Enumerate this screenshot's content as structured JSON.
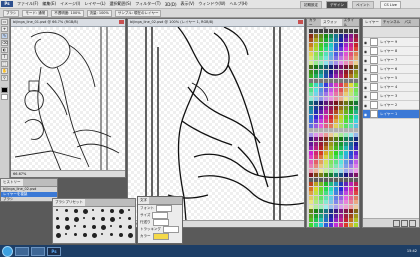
{
  "menubar": {
    "app_badge": "Ps",
    "items": [
      "ファイル(F)",
      "編集(E)",
      "イメージ(I)",
      "レイヤー(L)",
      "選択範囲(S)",
      "フィルター(T)",
      "3D(D)",
      "表示(V)",
      "ウィンドウ(W)",
      "ヘルプ(H)"
    ],
    "workspace_a": "初期設定",
    "workspace_b": "デザイン",
    "workspace_c": "ペイント",
    "search_label": "CS Live"
  },
  "optbar": {
    "items": [
      "ブラシ",
      "モード: 通常",
      "不透明度: 100%",
      "流量: 100%",
      "サンプル: 現在のレイヤー"
    ]
  },
  "toolbar": {
    "tools": [
      "▭",
      "⌖",
      "✎",
      "⌫",
      "◐",
      "T",
      "⬚",
      "✋",
      "⚲"
    ]
  },
  "doc_left": {
    "title": "bijinga_line_01.psd @ 66.7% (RGB/8)",
    "status": "66.67%"
  },
  "doc_main": {
    "title": "bijinga_line_02.psd @ 100% (レイヤー 1, RGB/8)",
    "status": "100%"
  },
  "swatches": {
    "tabs": [
      "カラー",
      "スウォッチ",
      "スタイル"
    ]
  },
  "layers": {
    "tabs": [
      "レイヤー",
      "チャンネル",
      "パス"
    ],
    "rows": [
      {
        "label": "レイヤー 9",
        "selected": false
      },
      {
        "label": "レイヤー 8",
        "selected": false
      },
      {
        "label": "レイヤー 7",
        "selected": false
      },
      {
        "label": "レイヤー 6",
        "selected": false
      },
      {
        "label": "レイヤー 5",
        "selected": false
      },
      {
        "label": "レイヤー 4",
        "selected": false
      },
      {
        "label": "レイヤー 3",
        "selected": false
      },
      {
        "label": "レイヤー 2",
        "selected": false
      },
      {
        "label": "レイヤー 1",
        "selected": true
      }
    ]
  },
  "history": {
    "tab": "ヒストリー",
    "rows": [
      "bijinga_line_02.psd",
      "レイヤーを複製",
      "ブラシ"
    ]
  },
  "brushes": {
    "tab": "ブラシプリセット"
  },
  "character": {
    "tab": "文字",
    "rows": [
      "フォント",
      "サイズ",
      "行送り",
      "トラッキング",
      "カラー"
    ]
  },
  "taskbar": {
    "ps_label": "Ps",
    "tray_time": "15:42"
  },
  "colors": {
    "accent": "#3b79d6",
    "taskbar": "#1d3e66"
  }
}
